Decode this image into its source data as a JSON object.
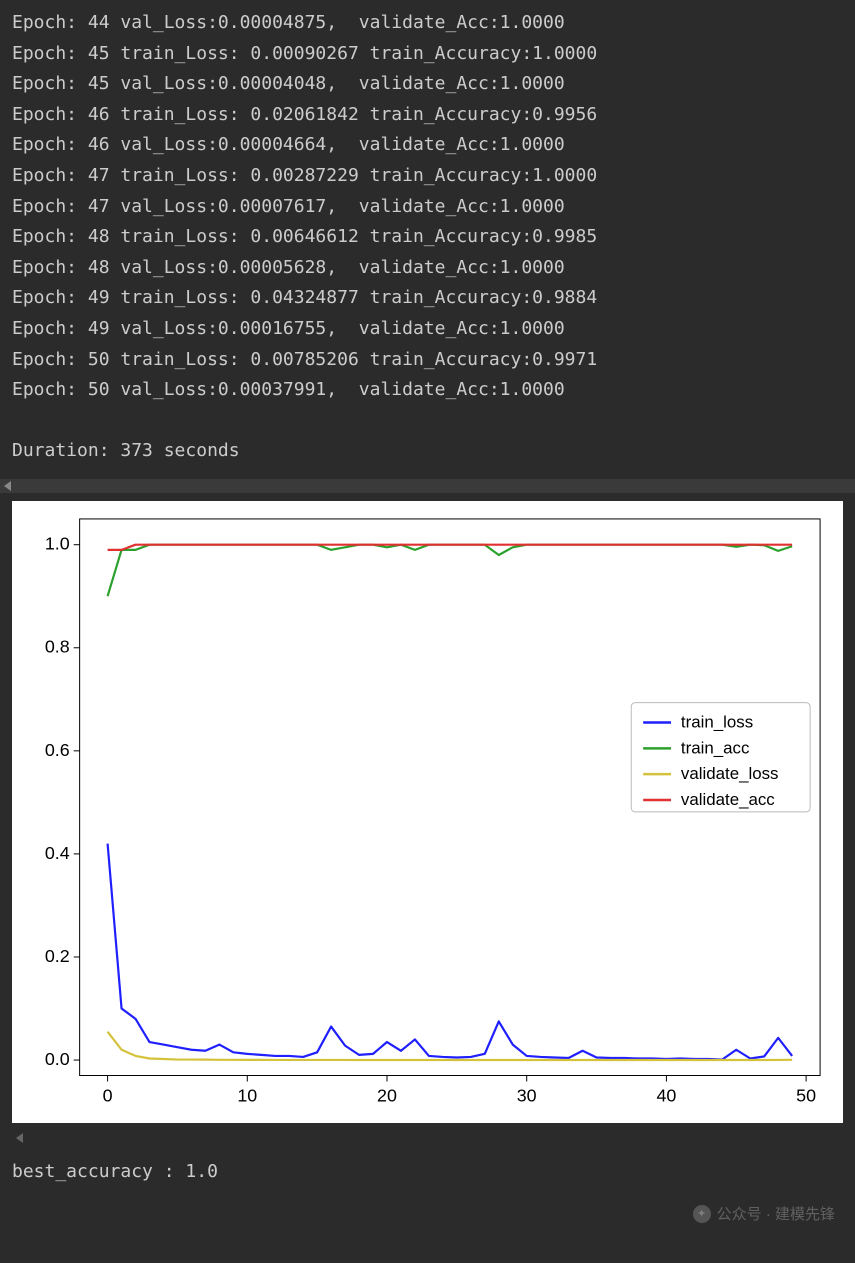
{
  "log_lines": [
    "Epoch: 44 val_Loss:0.00004875,  validate_Acc:1.0000",
    "Epoch: 45 train_Loss: 0.00090267 train_Accuracy:1.0000",
    "Epoch: 45 val_Loss:0.00004048,  validate_Acc:1.0000",
    "Epoch: 46 train_Loss: 0.02061842 train_Accuracy:0.9956",
    "Epoch: 46 val_Loss:0.00004664,  validate_Acc:1.0000",
    "Epoch: 47 train_Loss: 0.00287229 train_Accuracy:1.0000",
    "Epoch: 47 val_Loss:0.00007617,  validate_Acc:1.0000",
    "Epoch: 48 train_Loss: 0.00646612 train_Accuracy:0.9985",
    "Epoch: 48 val_Loss:0.00005628,  validate_Acc:1.0000",
    "Epoch: 49 train_Loss: 0.04324877 train_Accuracy:0.9884",
    "Epoch: 49 val_Loss:0.00016755,  validate_Acc:1.0000",
    "Epoch: 50 train_Loss: 0.00785206 train_Accuracy:0.9971",
    "Epoch: 50 val_Loss:0.00037991,  validate_Acc:1.0000"
  ],
  "duration_line": "Duration: 373 seconds",
  "best_line": "best_accuracy : 1.0",
  "watermark": "公众号 · 建模先锋",
  "legend": {
    "train_loss": "train_loss",
    "train_acc": "train_acc",
    "validate_loss": "validate_loss",
    "validate_acc": "validate_acc"
  },
  "chart_data": {
    "type": "line",
    "x": [
      0,
      1,
      2,
      3,
      4,
      5,
      6,
      7,
      8,
      9,
      10,
      11,
      12,
      13,
      14,
      15,
      16,
      17,
      18,
      19,
      20,
      21,
      22,
      23,
      24,
      25,
      26,
      27,
      28,
      29,
      30,
      31,
      32,
      33,
      34,
      35,
      36,
      37,
      38,
      39,
      40,
      41,
      42,
      43,
      44,
      45,
      46,
      47,
      48,
      49
    ],
    "xlim": [
      -2,
      51
    ],
    "ylim": [
      -0.03,
      1.05
    ],
    "xticks": [
      0,
      10,
      20,
      30,
      40,
      50
    ],
    "yticks": [
      0.0,
      0.2,
      0.4,
      0.6,
      0.8,
      1.0
    ],
    "legend_pos": "center-right",
    "series": [
      {
        "name": "train_loss",
        "color": "#1f1fff",
        "values": [
          0.42,
          0.1,
          0.08,
          0.035,
          0.03,
          0.025,
          0.02,
          0.018,
          0.03,
          0.015,
          0.012,
          0.01,
          0.008,
          0.008,
          0.006,
          0.015,
          0.065,
          0.028,
          0.01,
          0.012,
          0.035,
          0.018,
          0.04,
          0.008,
          0.006,
          0.005,
          0.006,
          0.012,
          0.075,
          0.03,
          0.008,
          0.006,
          0.005,
          0.004,
          0.018,
          0.005,
          0.004,
          0.004,
          0.003,
          0.003,
          0.002,
          0.003,
          0.002,
          0.002,
          0.001,
          0.02,
          0.003,
          0.007,
          0.043,
          0.008
        ]
      },
      {
        "name": "train_acc",
        "color": "#2ca02c",
        "values": [
          0.9,
          0.99,
          0.99,
          1.0,
          1.0,
          1.0,
          1.0,
          1.0,
          1.0,
          1.0,
          1.0,
          1.0,
          1.0,
          1.0,
          1.0,
          1.0,
          0.99,
          0.995,
          1.0,
          1.0,
          0.995,
          1.0,
          0.99,
          1.0,
          1.0,
          1.0,
          1.0,
          1.0,
          0.98,
          0.995,
          1.0,
          1.0,
          1.0,
          1.0,
          1.0,
          1.0,
          1.0,
          1.0,
          1.0,
          1.0,
          1.0,
          1.0,
          1.0,
          1.0,
          1.0,
          0.996,
          1.0,
          0.999,
          0.988,
          0.997
        ]
      },
      {
        "name": "validate_loss",
        "color": "#d4c23a",
        "values": [
          0.055,
          0.02,
          0.008,
          0.003,
          0.002,
          0.001,
          0.001,
          0.0008,
          0.0005,
          0.0004,
          0.0003,
          0.0003,
          0.0002,
          0.0002,
          0.0002,
          0.0002,
          0.0002,
          0.0002,
          0.0001,
          0.0001,
          0.0001,
          0.0001,
          0.0001,
          0.0001,
          0.0001,
          0.0001,
          0.0001,
          0.0001,
          0.0001,
          0.0001,
          0.0001,
          0.0001,
          0.0001,
          0.0001,
          0.0001,
          0.0001,
          0.0001,
          0.0001,
          0.0001,
          0.0001,
          0.0001,
          0.0001,
          0.0001,
          0.0001,
          0.0001,
          0.0001,
          0.0001,
          0.0001,
          0.0002,
          0.0004
        ]
      },
      {
        "name": "validate_acc",
        "color": "#e03030",
        "values": [
          0.99,
          0.99,
          1.0,
          1.0,
          1.0,
          1.0,
          1.0,
          1.0,
          1.0,
          1.0,
          1.0,
          1.0,
          1.0,
          1.0,
          1.0,
          1.0,
          1.0,
          1.0,
          1.0,
          1.0,
          1.0,
          1.0,
          1.0,
          1.0,
          1.0,
          1.0,
          1.0,
          1.0,
          1.0,
          1.0,
          1.0,
          1.0,
          1.0,
          1.0,
          1.0,
          1.0,
          1.0,
          1.0,
          1.0,
          1.0,
          1.0,
          1.0,
          1.0,
          1.0,
          1.0,
          1.0,
          1.0,
          1.0,
          1.0,
          1.0
        ]
      }
    ]
  }
}
